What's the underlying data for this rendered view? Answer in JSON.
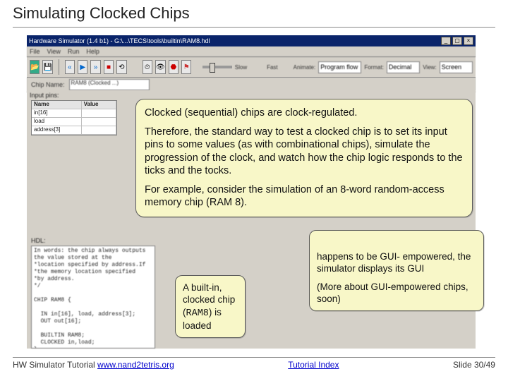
{
  "slide": {
    "title": "Simulating Clocked Chips"
  },
  "window": {
    "title": "Hardware Simulator (1.4 b1) - G:\\...\\TECS\\tools\\builtin\\RAM8.hdl",
    "menu": [
      "File",
      "View",
      "Run",
      "Help"
    ],
    "toolbar_labels": {
      "slow": "Slow",
      "fast": "Fast",
      "animate": "Animate:",
      "format": "Format:",
      "view": "View:"
    },
    "dropdowns": {
      "animate": "Program flow",
      "format": "Decimal",
      "view": "Screen"
    },
    "chip_label": "Chip Name:",
    "chip_value": "RAM8 (Clocked ...)"
  },
  "panels": {
    "input_pins_label": "Input pins:",
    "input_table": {
      "headers": [
        "Name",
        "Value"
      ],
      "rows": [
        [
          "in[16]",
          ""
        ],
        [
          "load",
          ""
        ],
        [
          "address[3]",
          ""
        ]
      ]
    },
    "hdl_label": "HDL:",
    "hdl_text": "In words: the chip always outputs\nthe value stored at the\n*location specified by address.If\n*the memory location specified\n*by address.\n*/\n\nCHIP RAM8 {\n\n  IN in[16], load, address[3];\n  OUT out[16];\n\n  BUILTIN RAM8;\n  CLOCKED in,load;\n}"
  },
  "callouts": {
    "main_p1": "Clocked (sequential) chips are clock-regulated.",
    "main_p2": "Therefore, the standard way to test a clocked chip is to set its input pins to some values (as with combinational chips), simulate the progression of the clock, and watch how the chip logic responds to the ticks and the tocks.",
    "main_p3": "For example, consider the simulation of an 8-word random-access memory chip (RAM 8).",
    "left_pre": "A built-in, clocked chip (",
    "left_mono": "RAM8",
    "left_post": ") is loaded",
    "right_tail": "happens to be GUI- empowered, the simulator displays its GUI",
    "right_p2": "(More about GUI-empowered chips, soon)"
  },
  "footer": {
    "left_text": "HW Simulator Tutorial ",
    "left_link": "www.nand2tetris.org",
    "center_link": "Tutorial Index",
    "right_text": "Slide 30/49"
  },
  "icons": {
    "open": "📂",
    "save": "💾",
    "step_back": "«",
    "step": "▶",
    "run": "»",
    "stop": "■",
    "rewind": "⟲",
    "clock": "⏲",
    "eye": "👁",
    "stopsign": "⬣",
    "flag": "⚑"
  }
}
